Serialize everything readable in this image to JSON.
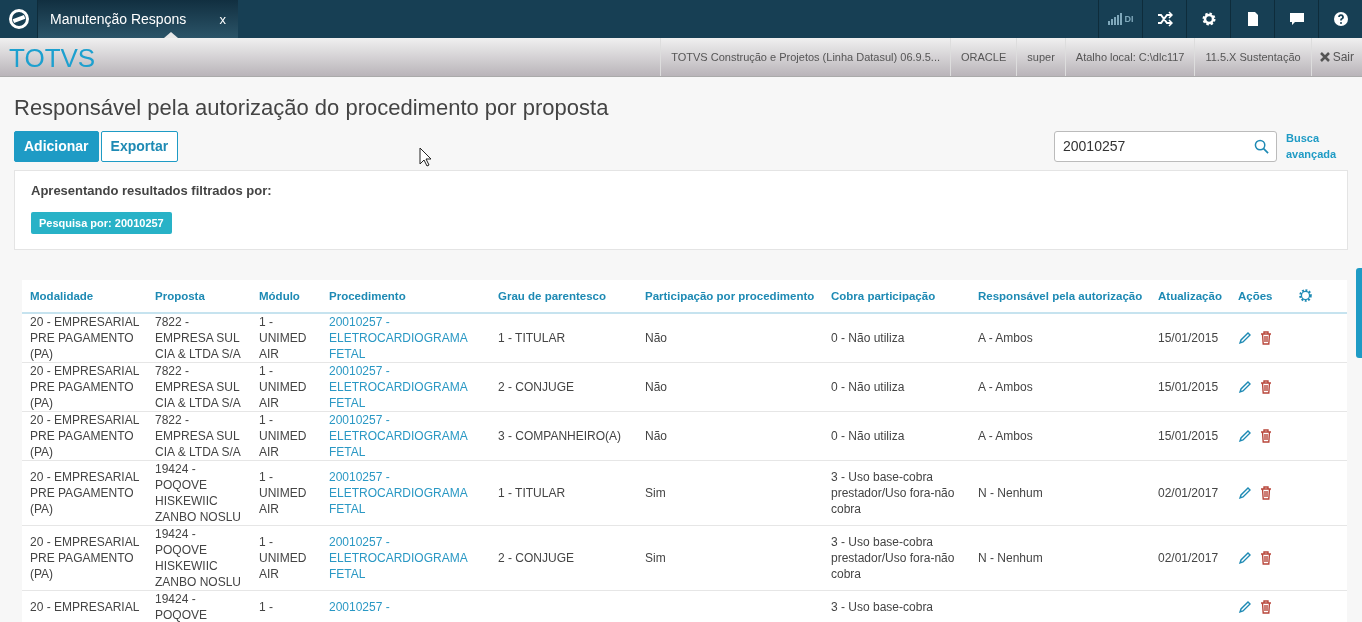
{
  "app_bar": {
    "tabs": [
      {
        "label": "Manutenção Respons",
        "selected": true,
        "close": "x"
      }
    ],
    "indicator": "DI"
  },
  "header": {
    "logo": "TOTVS",
    "items": [
      "TOTVS Construção e Projetos (Linha Datasul) 06.9.5...",
      "ORACLE",
      "super",
      "Atalho local: C:\\dlc117",
      "11.5.X Sustentação"
    ],
    "logout": "Sair"
  },
  "page": {
    "title": "Responsável pela autorização do procedimento por proposta",
    "buttons": [
      {
        "label": "Adicionar",
        "kind": "primary"
      },
      {
        "label": "Exportar",
        "kind": "secondary"
      }
    ],
    "search": {
      "value": "20010257"
    },
    "advanced_search": "Busca avançada",
    "filter": {
      "heading": "Apresentando resultados filtrados por:",
      "tags": [
        "Pesquisa por: 20010257"
      ]
    }
  },
  "table": {
    "columns": [
      {
        "label": "Modalidade",
        "kind": "text"
      },
      {
        "label": "Proposta",
        "kind": "text"
      },
      {
        "label": "Módulo",
        "kind": "text"
      },
      {
        "label": "Procedimento",
        "kind": "link"
      },
      {
        "label": "Grau de parentesco",
        "kind": "text"
      },
      {
        "label": "Participação por procedimento",
        "kind": "text"
      },
      {
        "label": "Cobra participação",
        "kind": "text"
      },
      {
        "label": "Responsável pela autorização",
        "kind": "text"
      },
      {
        "label": "Atualização",
        "kind": "text"
      },
      {
        "label": "Ações",
        "kind": "actions"
      }
    ],
    "rows": [
      {
        "cells": [
          "20 - EMPRESARIAL PRE PAGAMENTO (PA)",
          "7822 - EMPRESA SUL CIA & LTDA S/A",
          "1 - UNIMED AIR",
          "20010257 - ELETROCARDIOGRAMA FETAL",
          "1 - TITULAR",
          "Não",
          "0 - Não utiliza",
          "A - Ambos",
          "15/01/2015"
        ]
      },
      {
        "cells": [
          "20 - EMPRESARIAL PRE PAGAMENTO (PA)",
          "7822 - EMPRESA SUL CIA & LTDA S/A",
          "1 - UNIMED AIR",
          "20010257 - ELETROCARDIOGRAMA FETAL",
          "2 - CONJUGE",
          "Não",
          "0 - Não utiliza",
          "A - Ambos",
          "15/01/2015"
        ]
      },
      {
        "cells": [
          "20 - EMPRESARIAL PRE PAGAMENTO (PA)",
          "7822 - EMPRESA SUL CIA & LTDA S/A",
          "1 - UNIMED AIR",
          "20010257 - ELETROCARDIOGRAMA FETAL",
          "3 - COMPANHEIRO(A)",
          "Não",
          "0 - Não utiliza",
          "A - Ambos",
          "15/01/2015"
        ]
      },
      {
        "cells": [
          "20 - EMPRESARIAL PRE PAGAMENTO (PA)",
          "19424 - POQOVE HISKEWIIC ZANBO NOSLU",
          "1 - UNIMED AIR",
          "20010257 - ELETROCARDIOGRAMA FETAL",
          "1 - TITULAR",
          "Sim",
          "3 - Uso base-cobra prestador/Uso fora-não cobra",
          "N - Nenhum",
          "02/01/2017"
        ]
      },
      {
        "cells": [
          "20 - EMPRESARIAL PRE PAGAMENTO (PA)",
          "19424 - POQOVE HISKEWIIC ZANBO NOSLU",
          "1 - UNIMED AIR",
          "20010257 - ELETROCARDIOGRAMA FETAL",
          "2 - CONJUGE",
          "Sim",
          "3 - Uso base-cobra prestador/Uso fora-não cobra",
          "N - Nenhum",
          "02/01/2017"
        ]
      },
      {
        "cells": [
          "20 - EMPRESARIAL",
          "19424 - POQOVE",
          "1 -",
          "20010257 -",
          null,
          null,
          "3 - Uso base-cobra",
          null,
          null
        ]
      }
    ]
  }
}
